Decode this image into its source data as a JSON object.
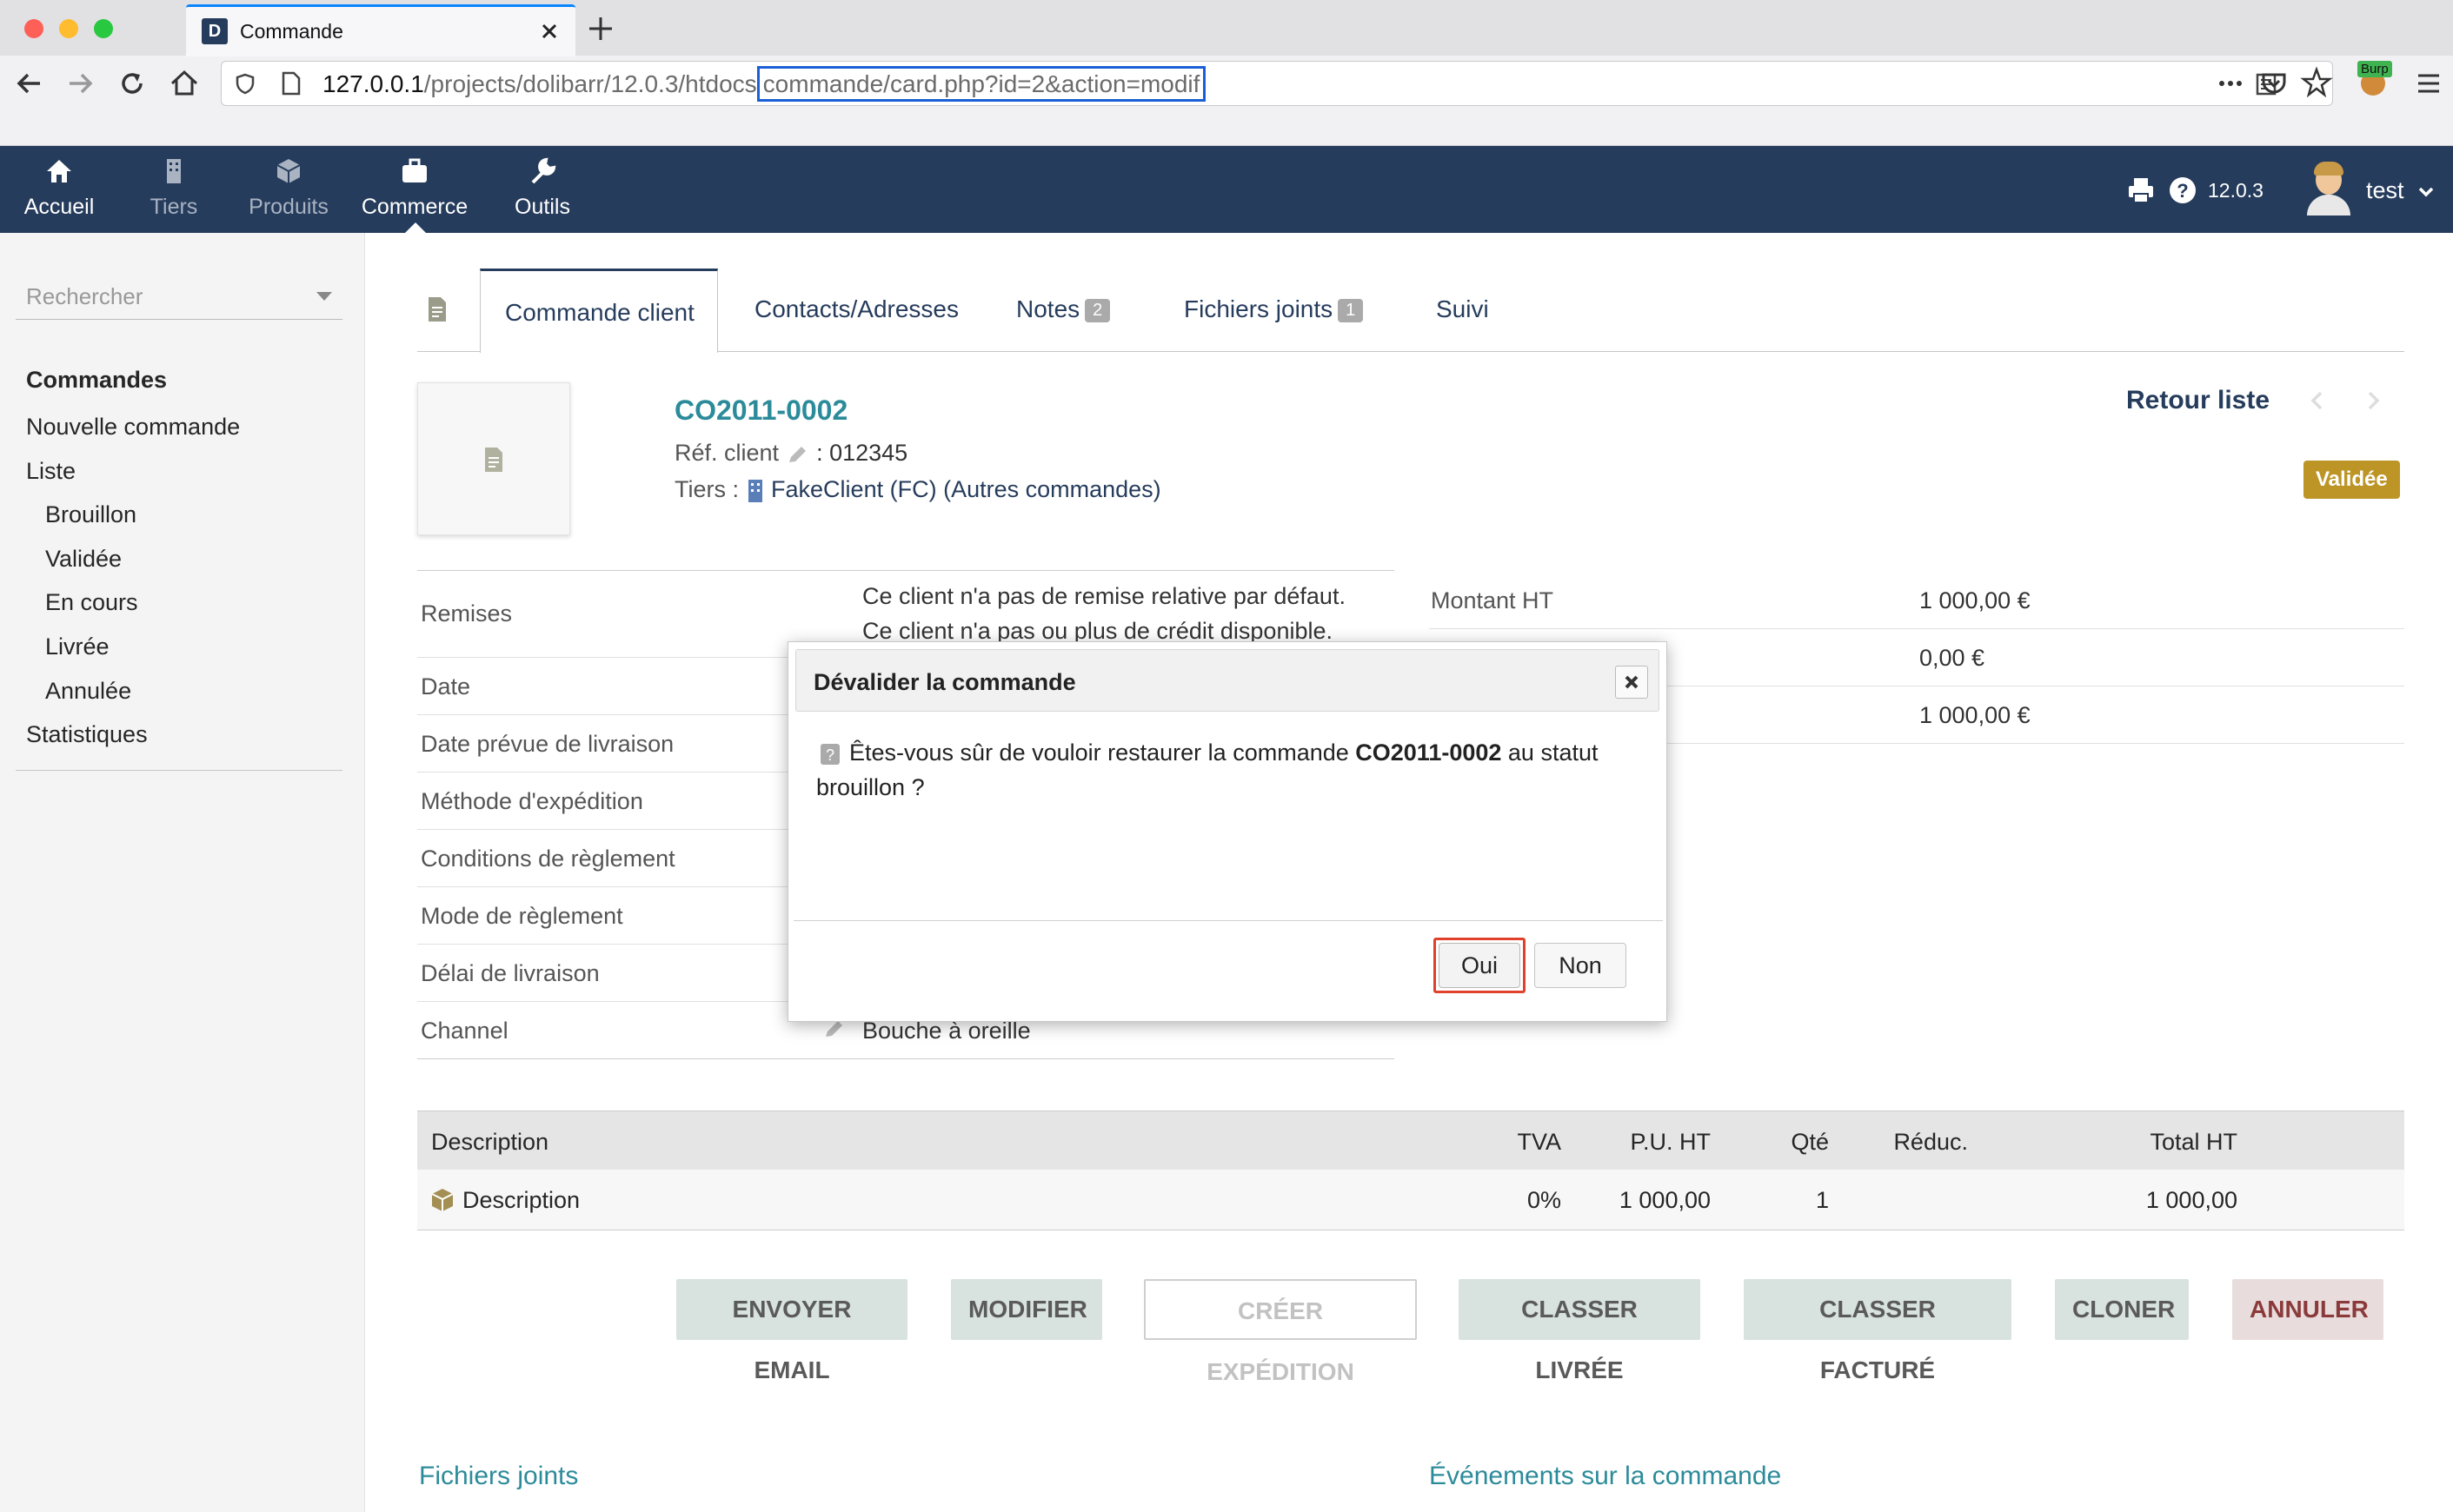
{
  "browser": {
    "tab_title": "Commande",
    "url_host": "127.0.0.1",
    "url_path_start": "/projects/dolibarr/12.0.3/htdocs",
    "url_highlight": "commande/card.php?id=2&action=modif",
    "burp_label": "Burp"
  },
  "topmenu": {
    "items": [
      "Accueil",
      "Tiers",
      "Produits",
      "Commerce",
      "Outils"
    ],
    "version": "12.0.3",
    "user": "test"
  },
  "leftmenu": {
    "search_placeholder": "Rechercher",
    "section": "Commandes",
    "new": "Nouvelle commande",
    "list": "Liste",
    "sub": [
      "Brouillon",
      "Validée",
      "En cours",
      "Livrée",
      "Annulée"
    ],
    "stats": "Statistiques"
  },
  "tabs": {
    "items": [
      {
        "label": "Commande client"
      },
      {
        "label": "Contacts/Adresses"
      },
      {
        "label": "Notes",
        "badge": "2"
      },
      {
        "label": "Fichiers joints",
        "badge": "1"
      },
      {
        "label": "Suivi"
      }
    ]
  },
  "order": {
    "ref": "CO2011-0002",
    "ref_client_label": "Réf. client",
    "ref_client_value": ": 012345",
    "tiers_label": "Tiers :",
    "tiers_name": "FakeClient (FC)",
    "tiers_other": "(Autres commandes)",
    "back_list": "Retour liste",
    "status": "Validée"
  },
  "fields": {
    "remises_label": "Remises",
    "remises_line1": "Ce client n'a pas de remise relative par défaut.",
    "remises_line2": "Ce client n'a pas ou plus de crédit disponible.",
    "labels": [
      "Date",
      "Date prévue de livraison",
      "Méthode d'expédition",
      "Conditions de règlement",
      "Mode de règlement",
      "Délai de livraison",
      "Channel"
    ],
    "channel_value": "Bouche à oreille"
  },
  "totals": {
    "montant_ht_label": "Montant HT",
    "montant_ht": "1 000,00 €",
    "tva": "0,00 €",
    "ttc": "1 000,00 €"
  },
  "lines": {
    "headers": [
      "Description",
      "TVA",
      "P.U. HT",
      "Qté",
      "Réduc.",
      "Total HT"
    ],
    "rows": [
      {
        "description": "Description",
        "tva": "0%",
        "pu": "1 000,00",
        "qty": "1",
        "reduc": "",
        "total": "1 000,00"
      }
    ]
  },
  "actions": {
    "buttons": [
      "ENVOYER EMAIL",
      "MODIFIER",
      "CRÉER EXPÉDITION",
      "CLASSER LIVRÉE",
      "CLASSER FACTURÉ",
      "CLONER",
      "ANNULER"
    ]
  },
  "footer": {
    "files": "Fichiers joints",
    "events": "Événements sur la commande"
  },
  "dialog": {
    "title": "Dévalider la commande",
    "msg_before": "Êtes-vous sûr de vouloir restaurer la commande ",
    "msg_ref": "CO2011-0002",
    "msg_after": " au statut",
    "msg_line2": "brouillon ?",
    "yes": "Oui",
    "no": "Non"
  },
  "colors": {
    "topbar": "#263c5c",
    "link": "#263c5c",
    "ref": "#2c8b9a",
    "status_badge": "#bc9526",
    "highlight_url": "#1a5fd6",
    "highlight_button": "#e0412c"
  }
}
